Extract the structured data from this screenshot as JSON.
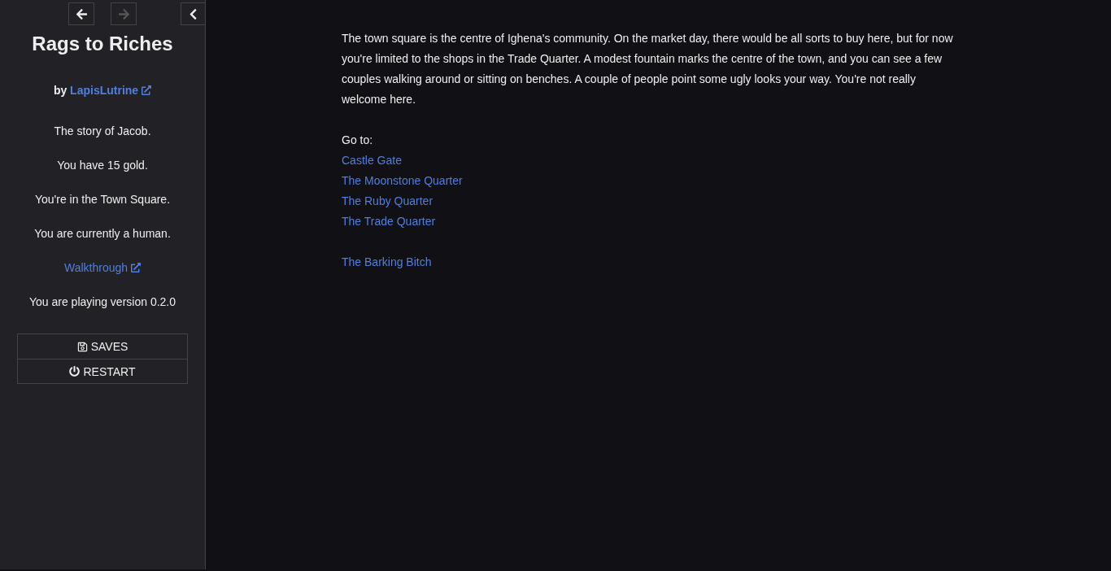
{
  "sidebar": {
    "history_buttons": [
      {
        "kind": "back",
        "disabled": false
      },
      {
        "kind": "forward",
        "disabled": true
      }
    ],
    "title": "Rags to Riches",
    "byline": {
      "prefix": "by",
      "author": "LapisLutrine"
    },
    "caption_lines": [
      {
        "kind": "text",
        "text": "The story of Jacob."
      },
      {
        "kind": "text",
        "text": "You have 15 gold."
      },
      {
        "kind": "text",
        "text": "You're in the Town Square."
      },
      {
        "kind": "text",
        "text": "You are currently a human."
      },
      {
        "kind": "link",
        "text": "Walkthrough"
      },
      {
        "kind": "text",
        "text": "You are playing version 0.2.0"
      }
    ],
    "menu": [
      {
        "kind": "saves",
        "label": "SAVES"
      },
      {
        "kind": "restart",
        "label": "RESTART"
      }
    ]
  },
  "passage": {
    "paragraph": "The town square is the centre of Ighena's community. On the market day, there would be all sorts to buy here, but for now you're limited to the shops in the Trade Quarter. A modest fountain marks the centre of the town, and you can see a few couples walking around or sitting on benches. A couple of people point some ugly looks your way. You're not really welcome here.",
    "goto_label": "Go to:",
    "destinations": [
      "Castle Gate",
      "The Moonstone Quarter",
      "The Ruby Quarter",
      "The Trade Quarter"
    ],
    "extra_links": [
      "The Barking Bitch"
    ]
  }
}
